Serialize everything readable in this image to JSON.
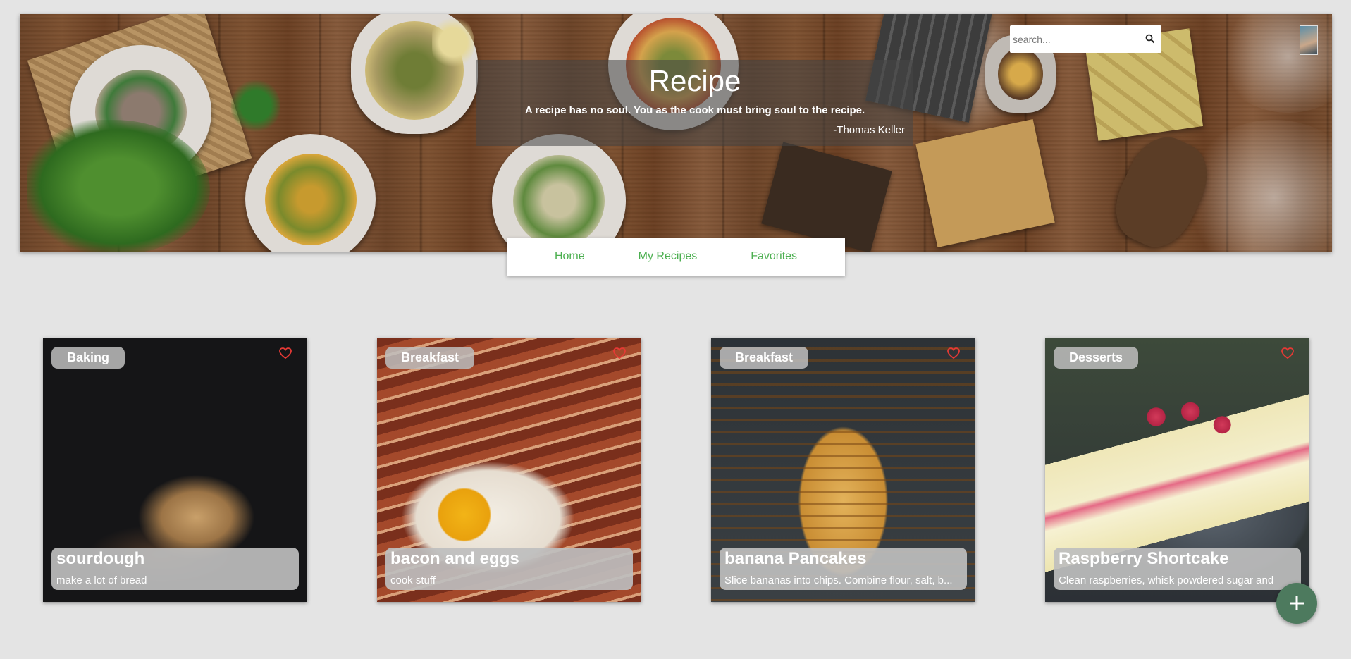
{
  "header": {
    "title": "Recipe",
    "quote": "A recipe has no soul. You as the cook must bring soul to the recipe.",
    "author": "-Thomas Keller"
  },
  "search": {
    "placeholder": "search...",
    "value": ""
  },
  "nav": {
    "home": "Home",
    "my_recipes": "My Recipes",
    "favorites": "Favorites"
  },
  "colors": {
    "nav_link": "#4caf50",
    "fab": "#4d7a5e",
    "heart": "#e53935",
    "page_bg": "#e4e4e4"
  },
  "icons": {
    "search": "search-icon",
    "favorite": "heart-outline-icon",
    "add": "plus-icon",
    "profile": "avatar"
  },
  "cards": [
    {
      "category": "Baking",
      "title": "sourdough",
      "description": "make a lot of bread"
    },
    {
      "category": "Breakfast",
      "title": "bacon and eggs",
      "description": "cook stuff"
    },
    {
      "category": "Breakfast",
      "title": "banana Pancakes",
      "description": "Slice bananas into chips. Combine flour, salt, b..."
    },
    {
      "category": "Desserts",
      "title": "Raspberry Shortcake",
      "description": "Clean raspberries, whisk powdered sugar and"
    }
  ]
}
